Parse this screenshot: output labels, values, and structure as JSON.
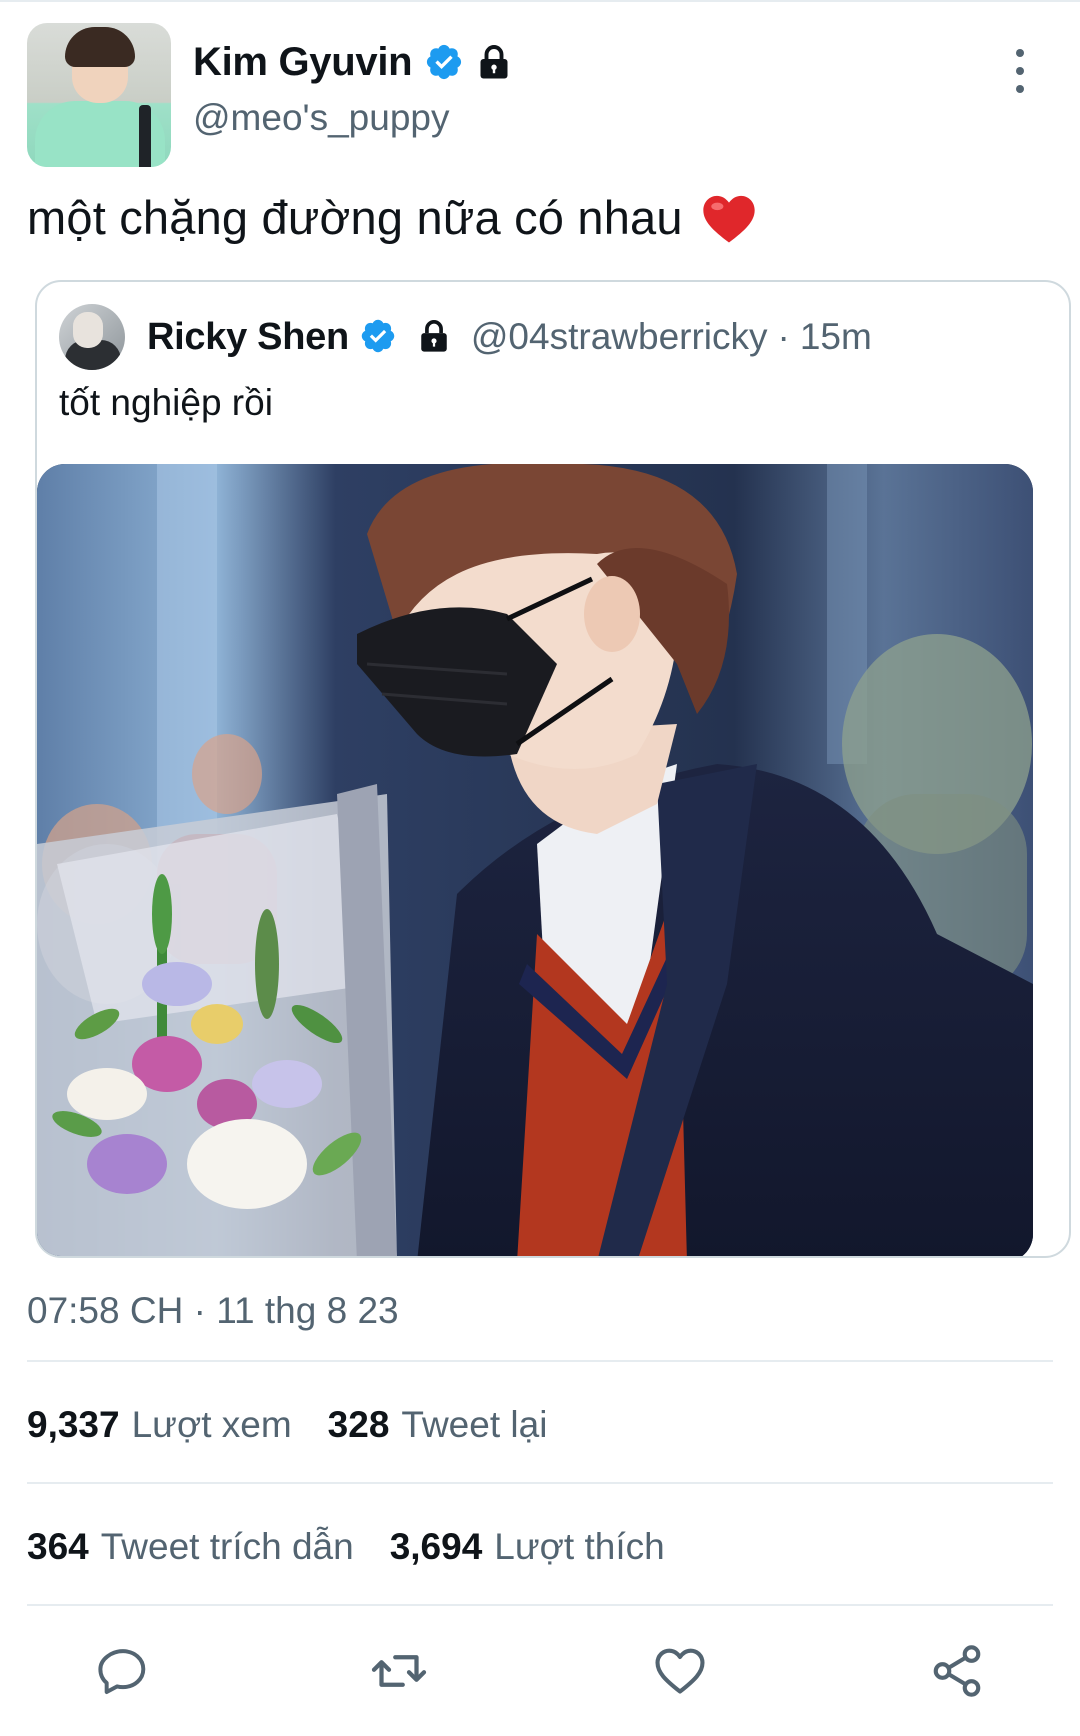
{
  "author": {
    "display_name": "Kim Gyuvin",
    "handle": "@meo's_puppy"
  },
  "tweet": {
    "text": "một chặng đường nữa có nhau"
  },
  "quoted_tweet": {
    "display_name": "Ricky Shen",
    "handle": "@04strawberricky",
    "separator": "·",
    "time": "15m",
    "text": "tốt nghiệp rồi"
  },
  "meta": {
    "timestamp": "07:58 CH · 11 thg 8 23"
  },
  "stats": {
    "views_count": "9,337",
    "views_label": "Lượt xem",
    "retweets_count": "328",
    "retweets_label": "Tweet lại",
    "quotes_count": "364",
    "quotes_label": "Tweet trích dẫn",
    "likes_count": "3,694",
    "likes_label": "Lượt thích"
  },
  "colors": {
    "verified_blue": "#1d9bf0",
    "secondary_text": "#536471",
    "primary_text": "#0f1419",
    "heart_red": "#e0272b"
  },
  "icons": {
    "verified": "verified-badge-icon",
    "lock": "lock-icon",
    "more": "more-vertical-icon",
    "reply": "reply-icon",
    "retweet": "retweet-icon",
    "like": "heart-outline-icon",
    "share": "share-icon",
    "emoji": "red-heart-emoji-icon"
  }
}
